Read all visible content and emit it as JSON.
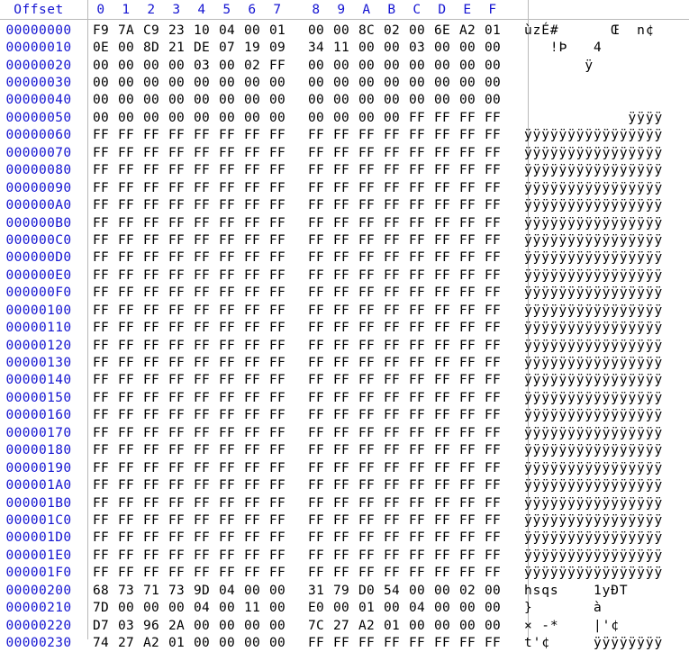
{
  "view": {
    "title": "hex-dump",
    "offset_header": "Offset",
    "column_headers": [
      "0",
      "1",
      "2",
      "3",
      "4",
      "5",
      "6",
      "7",
      "8",
      "9",
      "A",
      "B",
      "C",
      "D",
      "E",
      "F"
    ],
    "bytes_per_row": 16,
    "group_split_after": 8,
    "colors": {
      "background": "#ffffff",
      "offset_text": "#1414d2",
      "header_text": "#1414d2",
      "hex_text": "#000000",
      "ascii_text": "#000000",
      "separator": "#b9b9b9"
    }
  },
  "rows": [
    {
      "offset": "00000000",
      "bytes": [
        "F9",
        "7A",
        "C9",
        "23",
        "10",
        "04",
        "00",
        "01",
        "00",
        "00",
        "8C",
        "02",
        "00",
        "6E",
        "A2",
        "01"
      ],
      "ascii": "ùzÉ#      Œ  n¢"
    },
    {
      "offset": "00000010",
      "bytes": [
        "0E",
        "00",
        "8D",
        "21",
        "DE",
        "07",
        "19",
        "09",
        "34",
        "11",
        "00",
        "00",
        "03",
        "00",
        "00",
        "00"
      ],
      "ascii": "   !Þ   4"
    },
    {
      "offset": "00000020",
      "bytes": [
        "00",
        "00",
        "00",
        "00",
        "03",
        "00",
        "02",
        "FF",
        "00",
        "00",
        "00",
        "00",
        "00",
        "00",
        "00",
        "00"
      ],
      "ascii": "       ÿ"
    },
    {
      "offset": "00000030",
      "bytes": [
        "00",
        "00",
        "00",
        "00",
        "00",
        "00",
        "00",
        "00",
        "00",
        "00",
        "00",
        "00",
        "00",
        "00",
        "00",
        "00"
      ],
      "ascii": ""
    },
    {
      "offset": "00000040",
      "bytes": [
        "00",
        "00",
        "00",
        "00",
        "00",
        "00",
        "00",
        "00",
        "00",
        "00",
        "00",
        "00",
        "00",
        "00",
        "00",
        "00"
      ],
      "ascii": ""
    },
    {
      "offset": "00000050",
      "bytes": [
        "00",
        "00",
        "00",
        "00",
        "00",
        "00",
        "00",
        "00",
        "00",
        "00",
        "00",
        "00",
        "FF",
        "FF",
        "FF",
        "FF"
      ],
      "ascii": "            ÿÿÿÿ"
    },
    {
      "offset": "00000060",
      "bytes": [
        "FF",
        "FF",
        "FF",
        "FF",
        "FF",
        "FF",
        "FF",
        "FF",
        "FF",
        "FF",
        "FF",
        "FF",
        "FF",
        "FF",
        "FF",
        "FF"
      ],
      "ascii": "ÿÿÿÿÿÿÿÿÿÿÿÿÿÿÿÿ"
    },
    {
      "offset": "00000070",
      "bytes": [
        "FF",
        "FF",
        "FF",
        "FF",
        "FF",
        "FF",
        "FF",
        "FF",
        "FF",
        "FF",
        "FF",
        "FF",
        "FF",
        "FF",
        "FF",
        "FF"
      ],
      "ascii": "ÿÿÿÿÿÿÿÿÿÿÿÿÿÿÿÿ"
    },
    {
      "offset": "00000080",
      "bytes": [
        "FF",
        "FF",
        "FF",
        "FF",
        "FF",
        "FF",
        "FF",
        "FF",
        "FF",
        "FF",
        "FF",
        "FF",
        "FF",
        "FF",
        "FF",
        "FF"
      ],
      "ascii": "ÿÿÿÿÿÿÿÿÿÿÿÿÿÿÿÿ"
    },
    {
      "offset": "00000090",
      "bytes": [
        "FF",
        "FF",
        "FF",
        "FF",
        "FF",
        "FF",
        "FF",
        "FF",
        "FF",
        "FF",
        "FF",
        "FF",
        "FF",
        "FF",
        "FF",
        "FF"
      ],
      "ascii": "ÿÿÿÿÿÿÿÿÿÿÿÿÿÿÿÿ"
    },
    {
      "offset": "000000A0",
      "bytes": [
        "FF",
        "FF",
        "FF",
        "FF",
        "FF",
        "FF",
        "FF",
        "FF",
        "FF",
        "FF",
        "FF",
        "FF",
        "FF",
        "FF",
        "FF",
        "FF"
      ],
      "ascii": "ÿÿÿÿÿÿÿÿÿÿÿÿÿÿÿÿ"
    },
    {
      "offset": "000000B0",
      "bytes": [
        "FF",
        "FF",
        "FF",
        "FF",
        "FF",
        "FF",
        "FF",
        "FF",
        "FF",
        "FF",
        "FF",
        "FF",
        "FF",
        "FF",
        "FF",
        "FF"
      ],
      "ascii": "ÿÿÿÿÿÿÿÿÿÿÿÿÿÿÿÿ"
    },
    {
      "offset": "000000C0",
      "bytes": [
        "FF",
        "FF",
        "FF",
        "FF",
        "FF",
        "FF",
        "FF",
        "FF",
        "FF",
        "FF",
        "FF",
        "FF",
        "FF",
        "FF",
        "FF",
        "FF"
      ],
      "ascii": "ÿÿÿÿÿÿÿÿÿÿÿÿÿÿÿÿ"
    },
    {
      "offset": "000000D0",
      "bytes": [
        "FF",
        "FF",
        "FF",
        "FF",
        "FF",
        "FF",
        "FF",
        "FF",
        "FF",
        "FF",
        "FF",
        "FF",
        "FF",
        "FF",
        "FF",
        "FF"
      ],
      "ascii": "ÿÿÿÿÿÿÿÿÿÿÿÿÿÿÿÿ"
    },
    {
      "offset": "000000E0",
      "bytes": [
        "FF",
        "FF",
        "FF",
        "FF",
        "FF",
        "FF",
        "FF",
        "FF",
        "FF",
        "FF",
        "FF",
        "FF",
        "FF",
        "FF",
        "FF",
        "FF"
      ],
      "ascii": "ÿÿÿÿÿÿÿÿÿÿÿÿÿÿÿÿ"
    },
    {
      "offset": "000000F0",
      "bytes": [
        "FF",
        "FF",
        "FF",
        "FF",
        "FF",
        "FF",
        "FF",
        "FF",
        "FF",
        "FF",
        "FF",
        "FF",
        "FF",
        "FF",
        "FF",
        "FF"
      ],
      "ascii": "ÿÿÿÿÿÿÿÿÿÿÿÿÿÿÿÿ"
    },
    {
      "offset": "00000100",
      "bytes": [
        "FF",
        "FF",
        "FF",
        "FF",
        "FF",
        "FF",
        "FF",
        "FF",
        "FF",
        "FF",
        "FF",
        "FF",
        "FF",
        "FF",
        "FF",
        "FF"
      ],
      "ascii": "ÿÿÿÿÿÿÿÿÿÿÿÿÿÿÿÿ"
    },
    {
      "offset": "00000110",
      "bytes": [
        "FF",
        "FF",
        "FF",
        "FF",
        "FF",
        "FF",
        "FF",
        "FF",
        "FF",
        "FF",
        "FF",
        "FF",
        "FF",
        "FF",
        "FF",
        "FF"
      ],
      "ascii": "ÿÿÿÿÿÿÿÿÿÿÿÿÿÿÿÿ"
    },
    {
      "offset": "00000120",
      "bytes": [
        "FF",
        "FF",
        "FF",
        "FF",
        "FF",
        "FF",
        "FF",
        "FF",
        "FF",
        "FF",
        "FF",
        "FF",
        "FF",
        "FF",
        "FF",
        "FF"
      ],
      "ascii": "ÿÿÿÿÿÿÿÿÿÿÿÿÿÿÿÿ"
    },
    {
      "offset": "00000130",
      "bytes": [
        "FF",
        "FF",
        "FF",
        "FF",
        "FF",
        "FF",
        "FF",
        "FF",
        "FF",
        "FF",
        "FF",
        "FF",
        "FF",
        "FF",
        "FF",
        "FF"
      ],
      "ascii": "ÿÿÿÿÿÿÿÿÿÿÿÿÿÿÿÿ"
    },
    {
      "offset": "00000140",
      "bytes": [
        "FF",
        "FF",
        "FF",
        "FF",
        "FF",
        "FF",
        "FF",
        "FF",
        "FF",
        "FF",
        "FF",
        "FF",
        "FF",
        "FF",
        "FF",
        "FF"
      ],
      "ascii": "ÿÿÿÿÿÿÿÿÿÿÿÿÿÿÿÿ"
    },
    {
      "offset": "00000150",
      "bytes": [
        "FF",
        "FF",
        "FF",
        "FF",
        "FF",
        "FF",
        "FF",
        "FF",
        "FF",
        "FF",
        "FF",
        "FF",
        "FF",
        "FF",
        "FF",
        "FF"
      ],
      "ascii": "ÿÿÿÿÿÿÿÿÿÿÿÿÿÿÿÿ"
    },
    {
      "offset": "00000160",
      "bytes": [
        "FF",
        "FF",
        "FF",
        "FF",
        "FF",
        "FF",
        "FF",
        "FF",
        "FF",
        "FF",
        "FF",
        "FF",
        "FF",
        "FF",
        "FF",
        "FF"
      ],
      "ascii": "ÿÿÿÿÿÿÿÿÿÿÿÿÿÿÿÿ"
    },
    {
      "offset": "00000170",
      "bytes": [
        "FF",
        "FF",
        "FF",
        "FF",
        "FF",
        "FF",
        "FF",
        "FF",
        "FF",
        "FF",
        "FF",
        "FF",
        "FF",
        "FF",
        "FF",
        "FF"
      ],
      "ascii": "ÿÿÿÿÿÿÿÿÿÿÿÿÿÿÿÿ"
    },
    {
      "offset": "00000180",
      "bytes": [
        "FF",
        "FF",
        "FF",
        "FF",
        "FF",
        "FF",
        "FF",
        "FF",
        "FF",
        "FF",
        "FF",
        "FF",
        "FF",
        "FF",
        "FF",
        "FF"
      ],
      "ascii": "ÿÿÿÿÿÿÿÿÿÿÿÿÿÿÿÿ"
    },
    {
      "offset": "00000190",
      "bytes": [
        "FF",
        "FF",
        "FF",
        "FF",
        "FF",
        "FF",
        "FF",
        "FF",
        "FF",
        "FF",
        "FF",
        "FF",
        "FF",
        "FF",
        "FF",
        "FF"
      ],
      "ascii": "ÿÿÿÿÿÿÿÿÿÿÿÿÿÿÿÿ"
    },
    {
      "offset": "000001A0",
      "bytes": [
        "FF",
        "FF",
        "FF",
        "FF",
        "FF",
        "FF",
        "FF",
        "FF",
        "FF",
        "FF",
        "FF",
        "FF",
        "FF",
        "FF",
        "FF",
        "FF"
      ],
      "ascii": "ÿÿÿÿÿÿÿÿÿÿÿÿÿÿÿÿ"
    },
    {
      "offset": "000001B0",
      "bytes": [
        "FF",
        "FF",
        "FF",
        "FF",
        "FF",
        "FF",
        "FF",
        "FF",
        "FF",
        "FF",
        "FF",
        "FF",
        "FF",
        "FF",
        "FF",
        "FF"
      ],
      "ascii": "ÿÿÿÿÿÿÿÿÿÿÿÿÿÿÿÿ"
    },
    {
      "offset": "000001C0",
      "bytes": [
        "FF",
        "FF",
        "FF",
        "FF",
        "FF",
        "FF",
        "FF",
        "FF",
        "FF",
        "FF",
        "FF",
        "FF",
        "FF",
        "FF",
        "FF",
        "FF"
      ],
      "ascii": "ÿÿÿÿÿÿÿÿÿÿÿÿÿÿÿÿ"
    },
    {
      "offset": "000001D0",
      "bytes": [
        "FF",
        "FF",
        "FF",
        "FF",
        "FF",
        "FF",
        "FF",
        "FF",
        "FF",
        "FF",
        "FF",
        "FF",
        "FF",
        "FF",
        "FF",
        "FF"
      ],
      "ascii": "ÿÿÿÿÿÿÿÿÿÿÿÿÿÿÿÿ"
    },
    {
      "offset": "000001E0",
      "bytes": [
        "FF",
        "FF",
        "FF",
        "FF",
        "FF",
        "FF",
        "FF",
        "FF",
        "FF",
        "FF",
        "FF",
        "FF",
        "FF",
        "FF",
        "FF",
        "FF"
      ],
      "ascii": "ÿÿÿÿÿÿÿÿÿÿÿÿÿÿÿÿ"
    },
    {
      "offset": "000001F0",
      "bytes": [
        "FF",
        "FF",
        "FF",
        "FF",
        "FF",
        "FF",
        "FF",
        "FF",
        "FF",
        "FF",
        "FF",
        "FF",
        "FF",
        "FF",
        "FF",
        "FF"
      ],
      "ascii": "ÿÿÿÿÿÿÿÿÿÿÿÿÿÿÿÿ"
    },
    {
      "offset": "00000200",
      "bytes": [
        "68",
        "73",
        "71",
        "73",
        "9D",
        "04",
        "00",
        "00",
        "31",
        "79",
        "D0",
        "54",
        "00",
        "00",
        "02",
        "00"
      ],
      "ascii": "hsqs    1yÐT"
    },
    {
      "offset": "00000210",
      "bytes": [
        "7D",
        "00",
        "00",
        "00",
        "04",
        "00",
        "11",
        "00",
        "E0",
        "00",
        "01",
        "00",
        "04",
        "00",
        "00",
        "00"
      ],
      "ascii": "}       à"
    },
    {
      "offset": "00000220",
      "bytes": [
        "D7",
        "03",
        "96",
        "2A",
        "00",
        "00",
        "00",
        "00",
        "7C",
        "27",
        "A2",
        "01",
        "00",
        "00",
        "00",
        "00"
      ],
      "ascii": "× -*    |'¢"
    },
    {
      "offset": "00000230",
      "bytes": [
        "74",
        "27",
        "A2",
        "01",
        "00",
        "00",
        "00",
        "00",
        "FF",
        "FF",
        "FF",
        "FF",
        "FF",
        "FF",
        "FF",
        "FF"
      ],
      "ascii": "t'¢     ÿÿÿÿÿÿÿÿ"
    }
  ]
}
